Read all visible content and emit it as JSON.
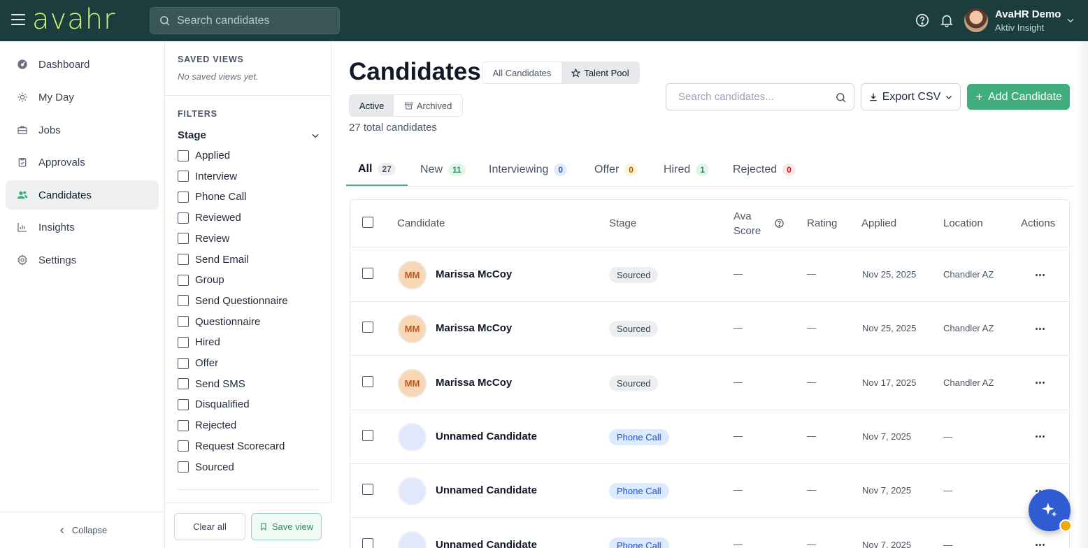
{
  "topbar": {
    "logo": "avahr",
    "search_placeholder": "Search candidates",
    "user_name": "AvaHR Demo",
    "user_org": "Aktiv Insight"
  },
  "nav": {
    "items": [
      {
        "label": "Dashboard",
        "icon": "dashboard-icon"
      },
      {
        "label": "My Day",
        "icon": "sun-icon"
      },
      {
        "label": "Jobs",
        "icon": "briefcase-icon"
      },
      {
        "label": "Approvals",
        "icon": "clipboard-check-icon"
      },
      {
        "label": "Candidates",
        "icon": "users-icon",
        "active": true
      },
      {
        "label": "Insights",
        "icon": "bar-chart-icon"
      },
      {
        "label": "Settings",
        "icon": "gear-icon"
      }
    ],
    "collapse_label": "Collapse"
  },
  "filters": {
    "saved_views_heading": "SAVED VIEWS",
    "no_saved_views": "No saved views yet.",
    "filters_heading": "FILTERS",
    "stage_heading": "Stage",
    "stages": [
      "Applied",
      "Interview",
      "Phone Call",
      "Reviewed",
      "Review",
      "Send Email",
      "Group",
      "Send Questionnaire",
      "Questionnaire",
      "Hired",
      "Offer",
      "Send SMS",
      "Disqualified",
      "Rejected",
      "Request Scorecard",
      "Sourced"
    ],
    "clear_all": "Clear all",
    "save_view": "Save view"
  },
  "main": {
    "title": "Candidates",
    "view_toggle": [
      "All Candidates",
      "Talent Pool"
    ],
    "status_toggle": [
      "Active",
      "Archived"
    ],
    "total": "27 total candidates",
    "search_placeholder": "Search candidates...",
    "export_label": "Export CSV",
    "add_label": "Add Candidate"
  },
  "tabs": [
    {
      "label": "All",
      "count": "27"
    },
    {
      "label": "New",
      "count": "11"
    },
    {
      "label": "Interviewing",
      "count": "0"
    },
    {
      "label": "Offer",
      "count": "0"
    },
    {
      "label": "Hired",
      "count": "1"
    },
    {
      "label": "Rejected",
      "count": "0"
    }
  ],
  "table": {
    "headers": {
      "candidate": "Candidate",
      "stage": "Stage",
      "ava_line1": "Ava",
      "ava_line2": "Score",
      "rating": "Rating",
      "applied": "Applied",
      "location": "Location",
      "actions": "Actions"
    },
    "rows": [
      {
        "initials": "MM",
        "name": "Marissa McCoy",
        "stage": "Sourced",
        "score": "—",
        "rating": "—",
        "applied": "Nov 25, 2025",
        "location": "Chandler AZ"
      },
      {
        "initials": "MM",
        "name": "Marissa McCoy",
        "stage": "Sourced",
        "score": "—",
        "rating": "—",
        "applied": "Nov 25, 2025",
        "location": "Chandler AZ"
      },
      {
        "initials": "MM",
        "name": "Marissa McCoy",
        "stage": "Sourced",
        "score": "—",
        "rating": "—",
        "applied": "Nov 17, 2025",
        "location": "Chandler AZ"
      },
      {
        "initials": "",
        "name": "Unnamed Candidate",
        "stage": "Phone Call",
        "score": "—",
        "rating": "—",
        "applied": "Nov 7, 2025",
        "location": "—"
      },
      {
        "initials": "",
        "name": "Unnamed Candidate",
        "stage": "Phone Call",
        "score": "—",
        "rating": "—",
        "applied": "Nov 7, 2025",
        "location": "—"
      },
      {
        "initials": "",
        "name": "Unnamed Candidate",
        "stage": "Phone Call",
        "score": "—",
        "rating": "—",
        "applied": "Nov 7, 2025",
        "location": "—"
      }
    ]
  },
  "colors": {
    "topbar": "#1c3d3d",
    "logo": "#d6f27a",
    "accent_green": "#3fae7c",
    "fab_blue": "#2f5bd3"
  }
}
